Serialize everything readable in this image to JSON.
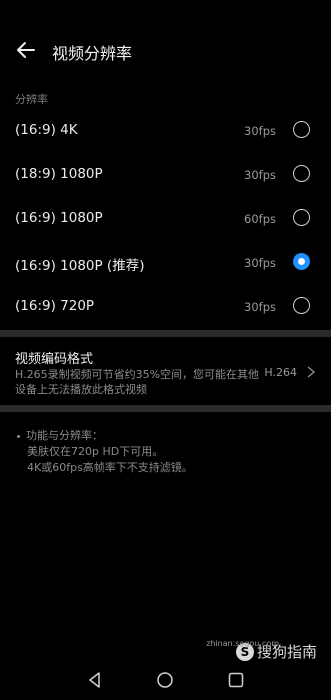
{
  "header": {
    "title": "视频分辨率",
    "back_icon": "arrow-left-icon"
  },
  "resolution": {
    "section_label": "分辨率",
    "items": [
      {
        "label": "(16:9) 4K",
        "fps": "30fps",
        "selected": false
      },
      {
        "label": "(18:9) 1080P",
        "fps": "30fps",
        "selected": false
      },
      {
        "label": "(16:9) 1080P",
        "fps": "60fps",
        "selected": false
      },
      {
        "label": "(16:9) 1080P (推荐)",
        "fps": "30fps",
        "selected": true
      },
      {
        "label": "(16:9) 720P",
        "fps": "30fps",
        "selected": false
      }
    ]
  },
  "codec": {
    "title": "视频编码格式",
    "description": "H.265录制视频可节省约35%空间，您可能在其他设备上无法播放此格式视频",
    "value": "H.264"
  },
  "notes": {
    "heading": "功能与分辨率：",
    "lines": [
      "美肤仅在720p HD下可用。",
      "4K或60fps高帧率下不支持滤镜。"
    ]
  },
  "watermark": {
    "logo_text": "S",
    "main": "搜狗指南",
    "sub": "zhinan.sogou.com"
  },
  "navbar": {
    "back_icon": "triangle-back-icon",
    "home_icon": "circle-home-icon",
    "recents_icon": "square-recents-icon"
  },
  "colors": {
    "accent": "#1e90ff",
    "background": "#000000"
  }
}
